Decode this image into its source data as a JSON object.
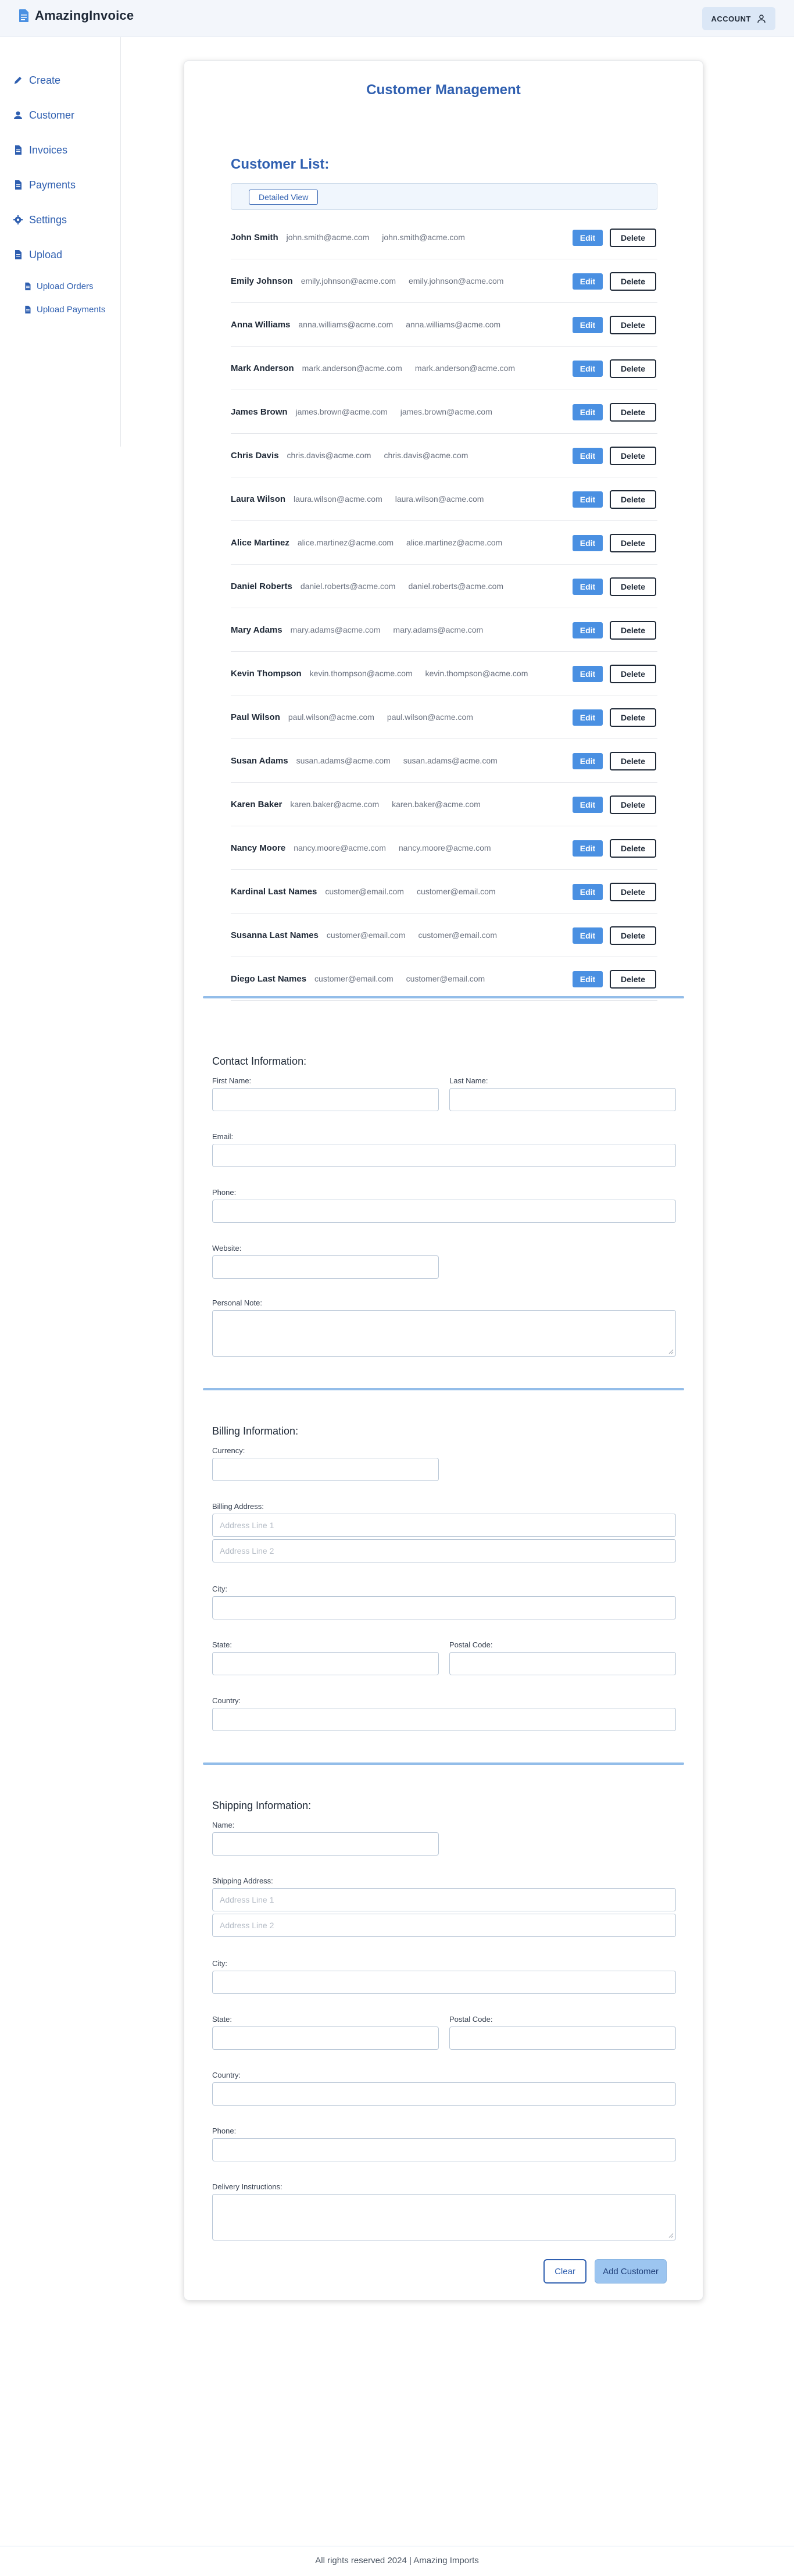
{
  "header": {
    "brand": "AmazingInvoice",
    "account_label": "ACCOUNT"
  },
  "sidebar": {
    "items": [
      {
        "label": "Create",
        "icon": "pencil-icon"
      },
      {
        "label": "Customer",
        "icon": "user-icon"
      },
      {
        "label": "Invoices",
        "icon": "file-icon"
      },
      {
        "label": "Payments",
        "icon": "file-icon"
      },
      {
        "label": "Settings",
        "icon": "gear-icon"
      },
      {
        "label": "Upload",
        "icon": "file-icon"
      }
    ],
    "subitems": [
      {
        "label": "Upload Orders",
        "icon": "file-icon"
      },
      {
        "label": "Upload Payments",
        "icon": "file-icon"
      }
    ]
  },
  "main": {
    "title": "Customer Management",
    "list_title": "Customer List:",
    "view_button": "Detailed View",
    "edit_label": "Edit",
    "delete_label": "Delete",
    "customers": [
      {
        "name": "John Smith",
        "email1": "john.smith@acme.com",
        "email2": "john.smith@acme.com"
      },
      {
        "name": "Emily Johnson",
        "email1": "emily.johnson@acme.com",
        "email2": "emily.johnson@acme.com"
      },
      {
        "name": "Anna Williams",
        "email1": "anna.williams@acme.com",
        "email2": "anna.williams@acme.com"
      },
      {
        "name": "Mark Anderson",
        "email1": "mark.anderson@acme.com",
        "email2": "mark.anderson@acme.com"
      },
      {
        "name": "James Brown",
        "email1": "james.brown@acme.com",
        "email2": "james.brown@acme.com"
      },
      {
        "name": "Chris Davis",
        "email1": "chris.davis@acme.com",
        "email2": "chris.davis@acme.com"
      },
      {
        "name": "Laura Wilson",
        "email1": "laura.wilson@acme.com",
        "email2": "laura.wilson@acme.com"
      },
      {
        "name": "Alice Martinez",
        "email1": "alice.martinez@acme.com",
        "email2": "alice.martinez@acme.com"
      },
      {
        "name": "Daniel Roberts",
        "email1": "daniel.roberts@acme.com",
        "email2": "daniel.roberts@acme.com"
      },
      {
        "name": "Mary Adams",
        "email1": "mary.adams@acme.com",
        "email2": "mary.adams@acme.com"
      },
      {
        "name": "Kevin Thompson",
        "email1": "kevin.thompson@acme.com",
        "email2": "kevin.thompson@acme.com"
      },
      {
        "name": "Paul Wilson",
        "email1": "paul.wilson@acme.com",
        "email2": "paul.wilson@acme.com"
      },
      {
        "name": "Susan Adams",
        "email1": "susan.adams@acme.com",
        "email2": "susan.adams@acme.com"
      },
      {
        "name": "Karen Baker",
        "email1": "karen.baker@acme.com",
        "email2": "karen.baker@acme.com"
      },
      {
        "name": "Nancy Moore",
        "email1": "nancy.moore@acme.com",
        "email2": "nancy.moore@acme.com"
      },
      {
        "name": "Kardinal Last Names",
        "email1": "customer@email.com",
        "email2": "customer@email.com"
      },
      {
        "name": "Susanna Last Names",
        "email1": "customer@email.com",
        "email2": "customer@email.com"
      },
      {
        "name": "Diego Last Names",
        "email1": "customer@email.com",
        "email2": "customer@email.com"
      }
    ]
  },
  "contact": {
    "title": "Contact Information:",
    "first_name": "First Name:",
    "last_name": "Last Name:",
    "email": "Email:",
    "phone": "Phone:",
    "website": "Website:",
    "note": "Personal Note:"
  },
  "billing": {
    "title": "Billing Information:",
    "currency": "Currency:",
    "address": "Billing Address:",
    "addr1_ph": "Address Line 1",
    "addr2_ph": "Address Line 2",
    "city": "City:",
    "state": "State:",
    "postal": "Postal Code:",
    "country": "Country:"
  },
  "shipping": {
    "title": "Shipping Information:",
    "name": "Name:",
    "address": "Shipping Address:",
    "addr1_ph": "Address Line 1",
    "addr2_ph": "Address Line 2",
    "city": "City:",
    "state": "State:",
    "postal": "Postal Code:",
    "country": "Country:",
    "phone": "Phone:",
    "instructions": "Delivery Instructions:"
  },
  "actions": {
    "clear": "Clear",
    "add": "Add Customer"
  },
  "footer": {
    "text": "All rights reserved 2024 | Amazing Imports"
  },
  "colors": {
    "accent": "#2f5fb0",
    "edit_button": "#4a90e2",
    "divider": "#93bde9",
    "header_bg": "#f3f6fb"
  }
}
